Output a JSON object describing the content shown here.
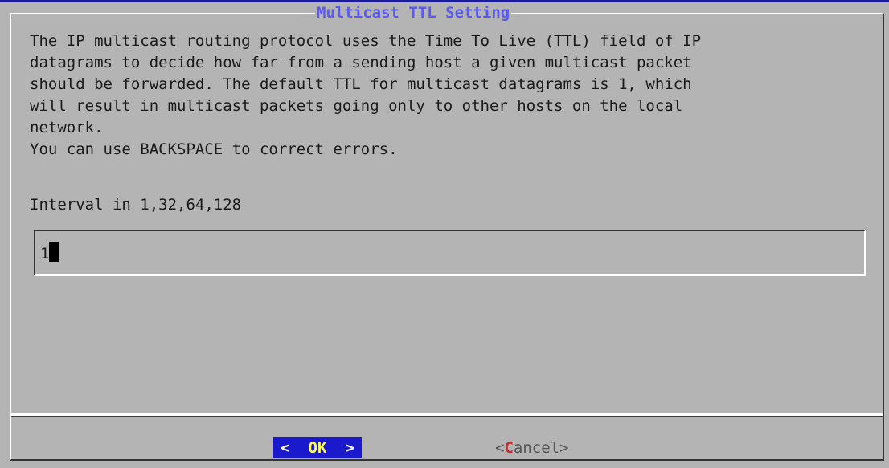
{
  "dialog": {
    "title": "Multicast TTL Setting",
    "description_lines": [
      "The IP multicast routing protocol uses the Time To Live (TTL) field of IP",
      "datagrams to decide how far from a sending host a given multicast packet",
      "should be forwarded. The default TTL for multicast datagrams is 1, which",
      "will result in multicast packets going only to other hosts on the local",
      "network.",
      "You can use BACKSPACE to correct errors."
    ],
    "prompt": "Interval in 1,32,64,128",
    "input_value": "1"
  },
  "buttons": {
    "ok": {
      "left": "<",
      "label": "OK",
      "right": ">"
    },
    "cancel": {
      "open": "<",
      "hotkey": "C",
      "rest": "ancel",
      "close": ">"
    }
  },
  "colors": {
    "background": "#b4b4b4",
    "title": "#5a5aee",
    "ok_bg": "#1a1acc",
    "ok_label": "#ffff44",
    "cancel_hotkey": "#cc2a2a"
  }
}
